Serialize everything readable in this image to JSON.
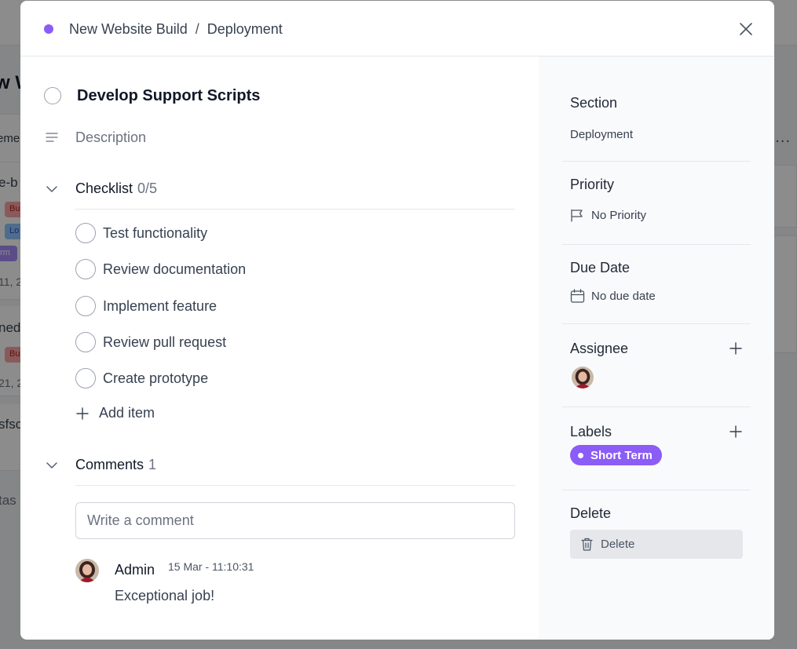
{
  "background": {
    "board_title_fragment": "w W",
    "column_header_fragment": "eme",
    "card1_title_fragment": "e-b",
    "card1_badges": [
      "Bu",
      "Lo",
      "rm"
    ],
    "card1_date": "11, 2",
    "card2_title_fragment": "ned",
    "card2_badge": "Bu",
    "card2_date": "21, 2",
    "card3_title_fragment": "sfsc",
    "add_task_fragment": "tas",
    "more_dots": "..."
  },
  "header": {
    "project": "New Website Build",
    "separator": "/",
    "section": "Deployment"
  },
  "task": {
    "title": "Develop Support Scripts",
    "description_placeholder": "Description"
  },
  "checklist": {
    "label": "Checklist",
    "count": "0/5",
    "items": [
      {
        "text": "Test functionality"
      },
      {
        "text": "Review documentation"
      },
      {
        "text": "Implement feature"
      },
      {
        "text": "Review pull request"
      },
      {
        "text": "Create prototype"
      }
    ],
    "add_label": "Add item"
  },
  "comments": {
    "label": "Comments",
    "count": "1",
    "input_placeholder": "Write a comment",
    "items": [
      {
        "author": "Admin",
        "time": "15 Mar - 11:10:31",
        "body": "Exceptional job!"
      }
    ]
  },
  "sidebar": {
    "section_label": "Section",
    "section_value": "Deployment",
    "priority_label": "Priority",
    "priority_value": "No Priority",
    "due_label": "Due Date",
    "due_value": "No due date",
    "assignee_label": "Assignee",
    "labels_label": "Labels",
    "label_chip": "Short Term",
    "delete_label": "Delete",
    "delete_button": "Delete"
  },
  "colors": {
    "accent": "#8b5cf6",
    "overlay": "rgba(0,0,0,0.45)"
  }
}
